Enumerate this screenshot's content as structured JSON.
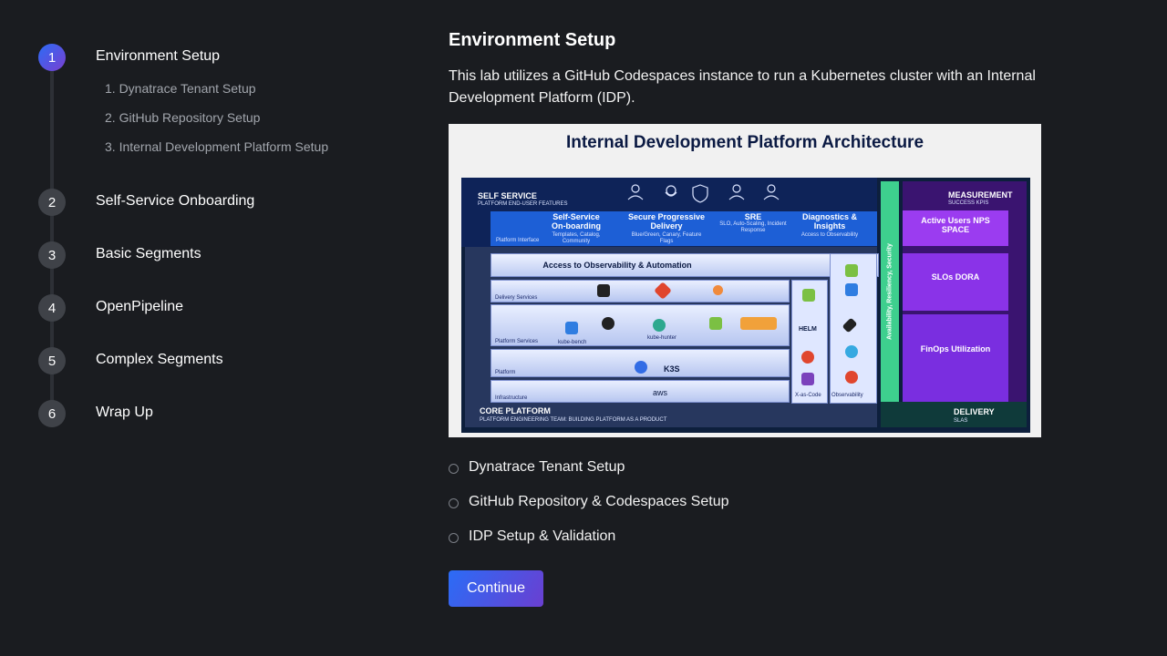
{
  "sidebar": {
    "steps": [
      {
        "number": "1",
        "title": "Environment Setup"
      },
      {
        "number": "2",
        "title": "Self-Service Onboarding"
      },
      {
        "number": "3",
        "title": "Basic Segments"
      },
      {
        "number": "4",
        "title": "OpenPipeline"
      },
      {
        "number": "5",
        "title": "Complex Segments"
      },
      {
        "number": "6",
        "title": "Wrap Up"
      }
    ],
    "substeps": [
      "1. Dynatrace Tenant Setup",
      "2. GitHub Repository Setup",
      "3. Internal Development Platform Setup"
    ],
    "active_step": "1"
  },
  "main": {
    "heading": "Environment Setup",
    "description": "This lab utilizes a GitHub Codespaces instance to run a Kubernetes cluster with an Internal Development Platform (IDP).",
    "figure": {
      "title": "Internal Development Platform Architecture",
      "self_service": "SELF SERVICE",
      "self_service_sub": "PLATFORM END-USER FEATURES",
      "platform_interface": "Platform Interface",
      "features": [
        {
          "title": "Self-Service On-boarding",
          "sub": "Templates, Catalog, Community"
        },
        {
          "title": "Secure Progressive Delivery",
          "sub": "Blue/Green, Canary, Feature Flags"
        },
        {
          "title": "SRE",
          "sub": "SLO, Auto-Scaling, Incident Response"
        },
        {
          "title": "Diagnostics & Insights",
          "sub": "Access to Observability"
        }
      ],
      "access": "Access to Observability & Automation",
      "layers": [
        "Delivery Services",
        "Platform Services",
        "Platform",
        "Infrastructure"
      ],
      "k3s": "K3S",
      "aws": "aws",
      "kube_bench": "kube-bench",
      "kube_hunter": "kube-hunter",
      "helm": "HELM",
      "x_as_code": "X-as-Code",
      "observability": "Observability",
      "vertical": "Availability, Resiliency, Security",
      "measurement": "MEASUREMENT",
      "measurement_sub": "SUCCESS KPIS",
      "kpis": [
        "Active Users NPS SPACE",
        "SLOs DORA",
        "FinOps Utilization"
      ],
      "core_platform": "CORE PLATFORM",
      "core_platform_sub": "PLATFORM ENGINEERING TEAM:  BUILDING PLATFORM AS A PRODUCT",
      "delivery": "DELIVERY",
      "delivery_sub": "SLAS"
    },
    "checklist": [
      "Dynatrace Tenant Setup",
      "GitHub Repository & Codespaces Setup",
      "IDP Setup & Validation"
    ],
    "continue_label": "Continue"
  },
  "colors": {
    "background": "#1a1c20",
    "accent_start": "#2b6cf6",
    "accent_end": "#7b3fd0"
  }
}
